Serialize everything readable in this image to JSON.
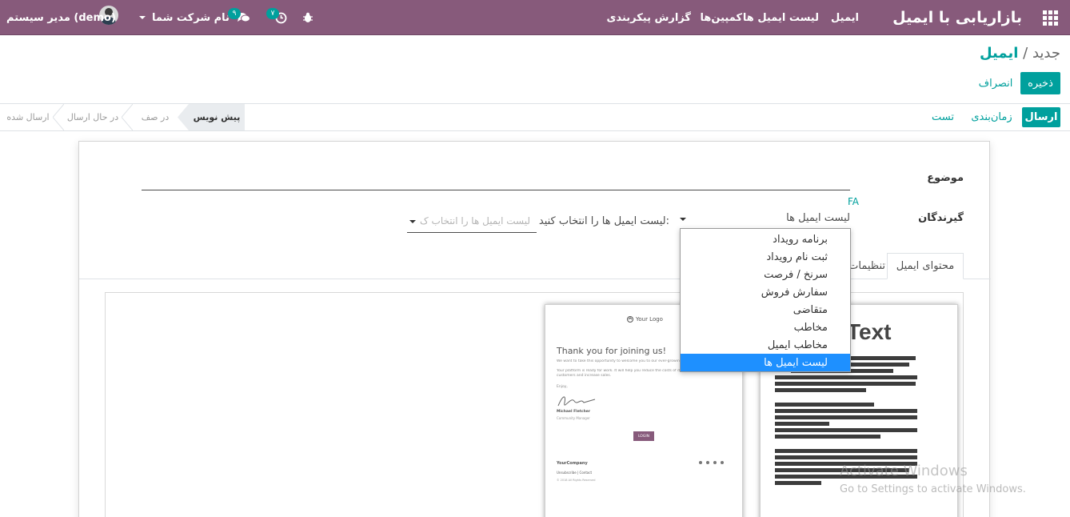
{
  "navbar": {
    "brand": "بازاریابی با ایمیل",
    "menu": [
      "ایمیل",
      "لیست ایمیل ها",
      "کمپین‌ها",
      "گزارش",
      "پیکربندی"
    ],
    "company": "نام شرکت شما",
    "user": "مدیر سیستم (demo)",
    "activity_count": "۷",
    "message_count": "۹"
  },
  "breadcrumb": {
    "parent": "ایمیل",
    "separator": "/",
    "current": "جدید"
  },
  "actions": {
    "save": "ذخیره",
    "discard": "انصراف"
  },
  "statusbar": {
    "buttons": {
      "send": "ارسال",
      "schedule": "زمان‌بندی",
      "test": "تست"
    },
    "stages": [
      "پیش نویس",
      "در صف",
      "در حال ارسال",
      "ارسال شده"
    ]
  },
  "form": {
    "subject_label": "موضوع",
    "lang_tag": "FA",
    "recipients_label": "گیرندگان",
    "recipients_value": "لیست ایمیل ها",
    "mailing_list_label": "لیست ایمیل ها را انتخاب کنید:",
    "mailing_list_placeholder": "لیست ایمیل ها را انتخاب ک",
    "tabs": [
      "محتوای ایمیل",
      "تنظیمات"
    ]
  },
  "dropdown": {
    "items": [
      "برنامه رویداد",
      "ثبت نام رویداد",
      "سرنخ / فرصت",
      "سفارش فروش",
      "متقاضی",
      "مخاطب",
      "مخاطب ایمیل",
      "لیست ایمیل ها"
    ],
    "selected": "لیست ایمیل ها"
  },
  "templates": {
    "welcome": {
      "logo": "Your Logo",
      "heading": "Thank you for joining us!",
      "p1": "We want to take this opportunity to welcome you to our ever-growing community!",
      "p2": "Your platform is ready for work. It will help you reduce the costs of digital signage, attract new customers and increase sales.",
      "enjoy": "Enjoy,",
      "signer": "Michael Fletcher",
      "signer_role": "Community Manager",
      "login": "LOGIN",
      "company": "YourCompany",
      "footer_links": "Unsubscribe | Contact",
      "copyright": "© 2018 All Rights Reserved"
    },
    "plain": {
      "title": "Text"
    }
  },
  "watermark": {
    "line1": "Activate Windows",
    "line2": "Go to Settings to activate Windows."
  }
}
